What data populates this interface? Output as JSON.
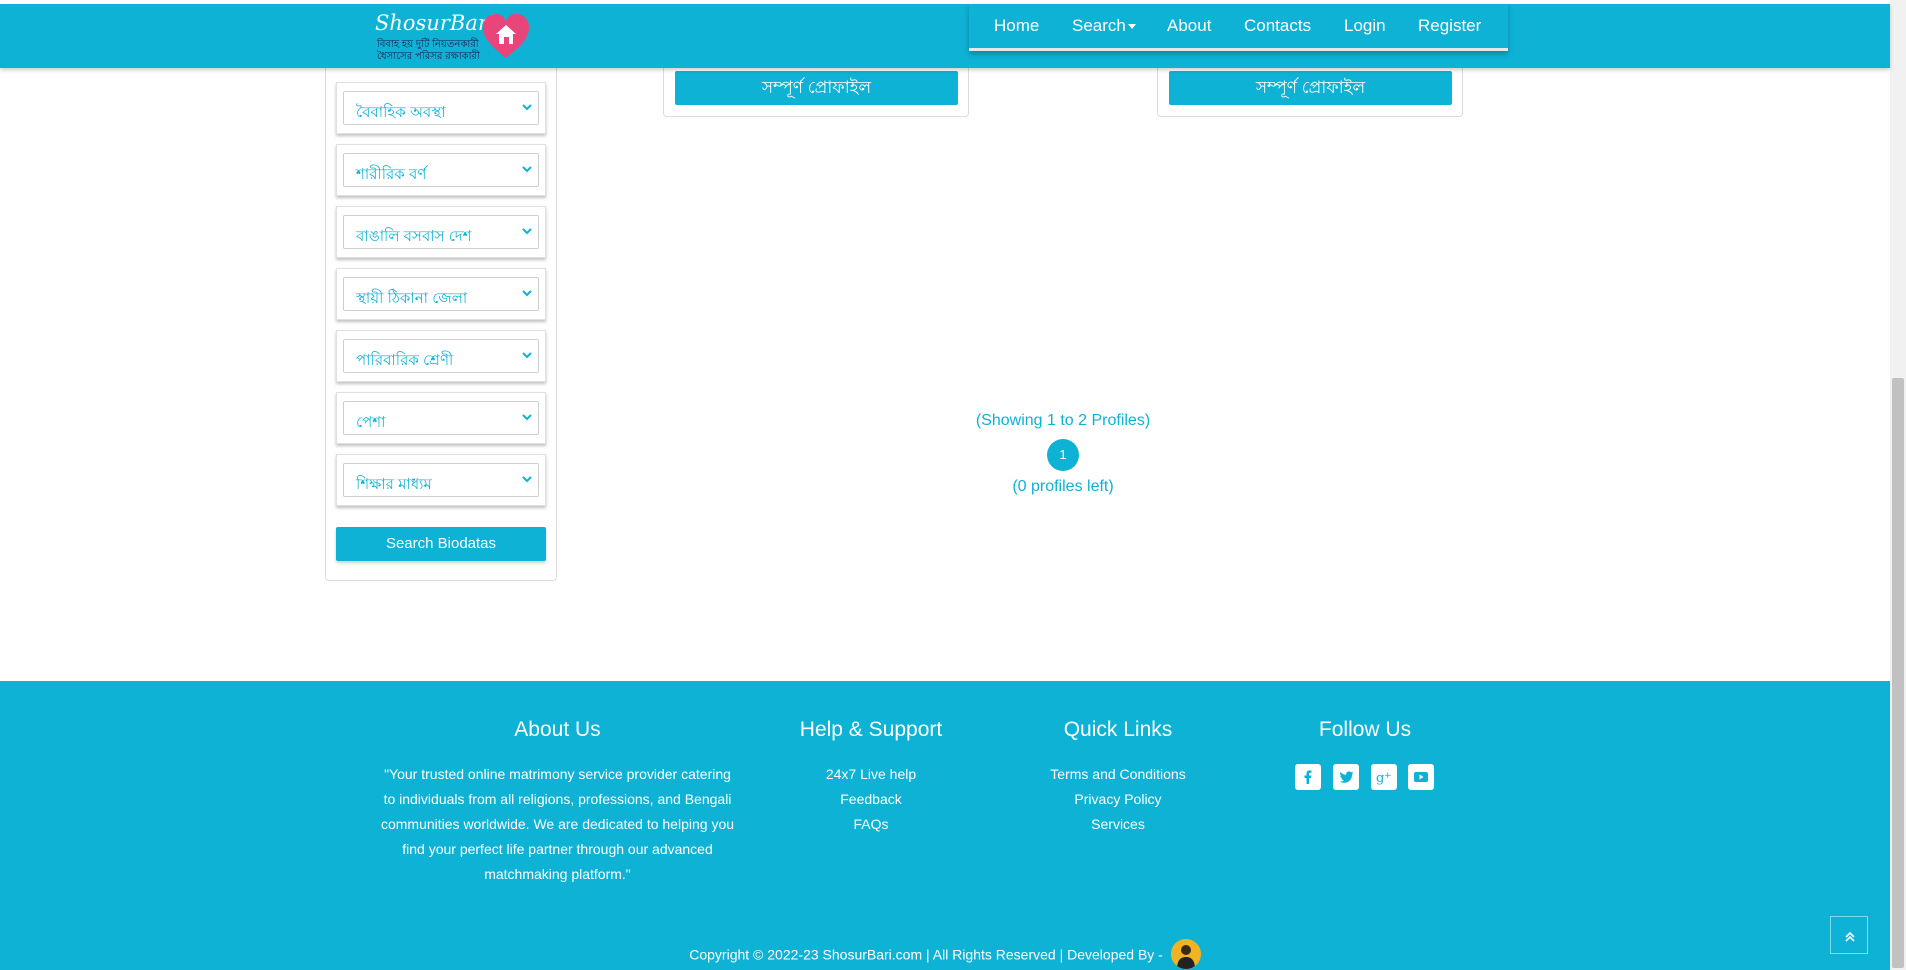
{
  "brand": {
    "name": "ShosurBari",
    "tagline_line1": "বিবাহ হয় দুটি নিয়তনকারী",
    "tagline_line2": "ধৈসাসের পরিসর রক্ষাকারী"
  },
  "nav": {
    "items": [
      "Home",
      "Search",
      "About",
      "Contacts",
      "Login",
      "Register"
    ]
  },
  "filters": [
    "বৈবাহিক অবস্থা",
    "শারীরিক বর্ণ",
    "বাঙালি বসবাস দেশ",
    "স্থায়ী ঠিকানা জেলা",
    "পারিবারিক শ্রেণী",
    "পেশা",
    "শিক্ষার মাধ্যম"
  ],
  "search_button": "Search Biodatas",
  "profiles": [
    {
      "button": "সম্পূর্ণ প্রোফাইল"
    },
    {
      "button": "সম্পূর্ণ প্রোফাইল"
    }
  ],
  "pagination": {
    "showing": "(Showing 1 to 2 Profiles)",
    "current_page": "1",
    "remaining": "(0 profiles left)"
  },
  "footer": {
    "about": {
      "heading": "About Us",
      "text": "\"Your trusted online matrimony service provider catering to individuals from all religions, professions, and Bengali communities worldwide. We are dedicated to helping you find your perfect life partner through our advanced matchmaking platform.\""
    },
    "help": {
      "heading": "Help & Support",
      "links": [
        "24x7 Live help",
        "Feedback",
        "FAQs"
      ]
    },
    "quick": {
      "heading": "Quick Links",
      "links": [
        "Terms and Conditions",
        "Privacy Policy",
        "Services"
      ]
    },
    "follow": {
      "heading": "Follow Us",
      "icons": [
        "facebook-icon",
        "twitter-icon",
        "google-plus-icon",
        "youtube-icon"
      ]
    },
    "copyright": "Copyright © 2022-23 ShosurBari.com | All Rights Reserved | Developed By -"
  },
  "colors": {
    "primary": "#0db2d5",
    "logo_heart": "#e8457a",
    "text_dark": "#333333"
  }
}
